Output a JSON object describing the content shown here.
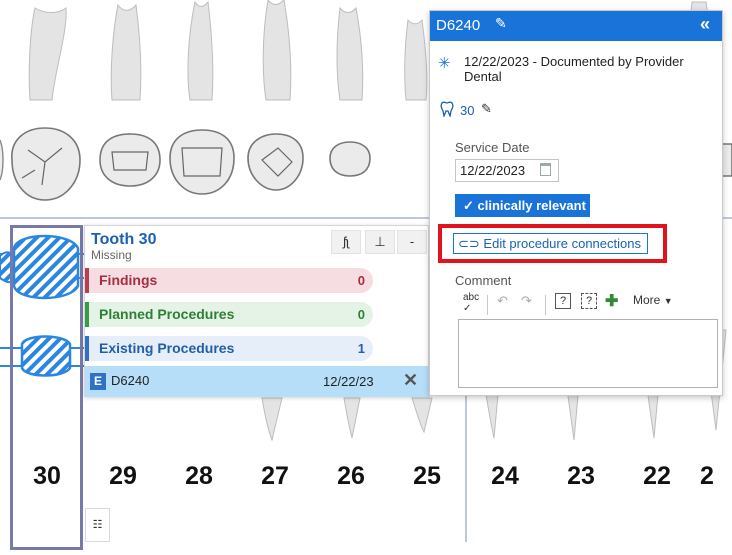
{
  "chart": {
    "tooth_numbers": [
      "30",
      "29",
      "28",
      "27",
      "26",
      "25",
      "24",
      "23",
      "22",
      "2"
    ],
    "selected_tooth": "30"
  },
  "tooth_panel": {
    "title": "Tooth 30",
    "status": "Missing",
    "buttons": {
      "roots": "ʃʅ",
      "pin": "⊥",
      "minus": "-"
    },
    "categories": [
      {
        "label": "Findings",
        "count": "0",
        "color": "#b8404f"
      },
      {
        "label": "Planned Procedures",
        "count": "0",
        "color": "#3b9b42"
      },
      {
        "label": "Existing Procedures",
        "count": "1",
        "color": "#2f72c4"
      }
    ],
    "procedure": {
      "badge": "E",
      "code": "D6240",
      "date": "12/22/23",
      "remove_icon": "close-icon"
    }
  },
  "list_button": {
    "icon": "list-icon",
    "glyph": "☷"
  },
  "detail_panel": {
    "code": "D6240",
    "collapse_glyph": "«",
    "documented": "12/22/2023 - Documented by Provider Dental",
    "tooth_number": "30",
    "service_date_label": "Service Date",
    "service_date_value": "12/22/2023",
    "relevant_label": "clinically relevant",
    "edit_connections_label": "Edit procedure connections",
    "comment_label": "Comment",
    "more_label": "More",
    "accent": "#1a73d9",
    "highlight": "#e3131d"
  }
}
